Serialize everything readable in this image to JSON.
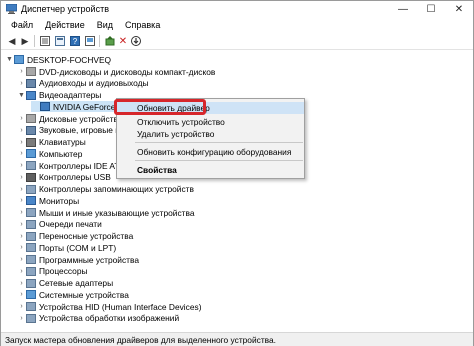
{
  "window": {
    "title": "Диспетчер устройств",
    "controls": {
      "minimize": "—",
      "maximize": "☐",
      "close": "✕"
    }
  },
  "menu": [
    "Файл",
    "Действие",
    "Вид",
    "Справка"
  ],
  "toolbar": {
    "icons": [
      "back-icon",
      "forward-icon",
      "view-icon",
      "properties-icon",
      "help-icon",
      "refresh-icon",
      "update-driver-icon",
      "remove-icon",
      "download-icon"
    ]
  },
  "tree": {
    "root": "DESKTOP-FOCHVEQ",
    "items": [
      {
        "label": "DVD-дисководы и дисководы компакт-дисков",
        "icon": "disk"
      },
      {
        "label": "Аудиовходы и аудиовыходы",
        "icon": "snd"
      },
      {
        "label": "Видеоадаптеры",
        "icon": "mon",
        "expanded": true
      },
      {
        "label": "NVIDIA GeForce GTX 1050",
        "icon": "gpu",
        "child": true,
        "selected": true
      },
      {
        "label": "Дисковые устройства",
        "icon": "disk"
      },
      {
        "label": "Звуковые, игровые и видеоустройства",
        "icon": "snd"
      },
      {
        "label": "Клавиатуры",
        "icon": "kbd"
      },
      {
        "label": "Компьютер",
        "icon": "pc"
      },
      {
        "label": "Контроллеры IDE ATA/ATAPI",
        "icon": "gen"
      },
      {
        "label": "Контроллеры USB",
        "icon": "usb"
      },
      {
        "label": "Контроллеры запоминающих устройств",
        "icon": "gen"
      },
      {
        "label": "Мониторы",
        "icon": "mon"
      },
      {
        "label": "Мыши и иные указывающие устройства",
        "icon": "gen"
      },
      {
        "label": "Очереди печати",
        "icon": "gen"
      },
      {
        "label": "Переносные устройства",
        "icon": "gen"
      },
      {
        "label": "Порты (COM и LPT)",
        "icon": "gen"
      },
      {
        "label": "Программные устройства",
        "icon": "gen"
      },
      {
        "label": "Процессоры",
        "icon": "gen"
      },
      {
        "label": "Сетевые адаптеры",
        "icon": "gen"
      },
      {
        "label": "Системные устройства",
        "icon": "pc"
      },
      {
        "label": "Устройства HID (Human Interface Devices)",
        "icon": "gen"
      },
      {
        "label": "Устройства обработки изображений",
        "icon": "gen"
      }
    ]
  },
  "context_menu": {
    "items": [
      {
        "label": "Обновить драйвер",
        "highlighted": true
      },
      {
        "label": "Отключить устройство"
      },
      {
        "label": "Удалить устройство"
      },
      {
        "label": "Обновить конфигурацию оборудования"
      },
      {
        "label": "Свойства",
        "bold": true
      }
    ]
  },
  "status": "Запуск мастера обновления драйверов для выделенного устройства.",
  "colors": {
    "highlight_box": "#d6262b",
    "selection": "#cce4f7"
  }
}
